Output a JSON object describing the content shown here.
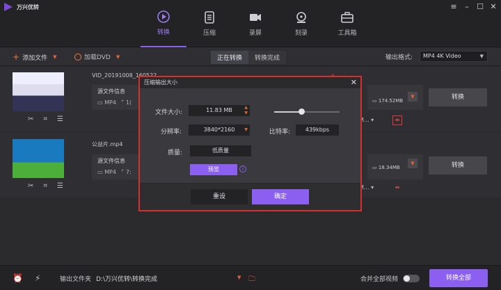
{
  "app": {
    "name": "万兴优转"
  },
  "window": {
    "controls": [
      "≡",
      "–",
      "☐",
      "✕"
    ]
  },
  "toolbar": {
    "tools": [
      {
        "label": "转换",
        "icon": "convert-icon",
        "active": true
      },
      {
        "label": "压缩",
        "icon": "compress-icon",
        "active": false
      },
      {
        "label": "录屏",
        "icon": "record-icon",
        "active": false
      },
      {
        "label": "刻录",
        "icon": "burn-icon",
        "active": false
      },
      {
        "label": "工具箱",
        "icon": "toolbox-icon",
        "active": false
      }
    ]
  },
  "subbar": {
    "add_file": "添加文件",
    "add_dvd": "加载DVD",
    "tab_converting": "正在转换",
    "tab_done": "转换完成",
    "output_format_label": "输出格式:",
    "output_format_value": "MP4 4K Video"
  },
  "files": [
    {
      "name": "VID_20191008_160522",
      "source_label": "源文件信息",
      "format": "MP4",
      "source_extra": "1(",
      "output_size": "174.52MB",
      "output_select": "M...",
      "convert": "转换"
    },
    {
      "name": "公益片.mp4",
      "source_label": "源文件信息",
      "format": "MP4",
      "source_extra": "7:",
      "output_size": "18.34MB",
      "output_select": "M...",
      "convert": "转换"
    }
  ],
  "dialog": {
    "title": "压缩输出大小",
    "file_size_label": "文件大小:",
    "file_size_value": "11.83  MB",
    "resolution_label": "分辨率:",
    "resolution_value": "3840*2160",
    "bitrate_label": "比特率:",
    "bitrate_value": "439kbps",
    "quality_label": "质量:",
    "quality_value": "低质量",
    "preview": "预览",
    "reset": "重设",
    "ok": "确定",
    "slider_fraction": 0.41
  },
  "bottom": {
    "output_folder_label": "输出文件夹",
    "output_path": "D:\\万兴优转\\转换完成",
    "merge_label": "合并全部视频",
    "convert_all": "转换全部"
  },
  "colors": {
    "accent": "#8b5ff0",
    "orange": "#e0673a",
    "highlight_red": "#d92e2e"
  }
}
